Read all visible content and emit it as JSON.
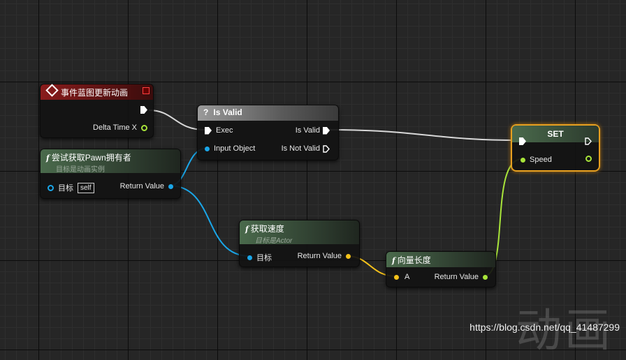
{
  "colors": {
    "exec": "#ffffff",
    "float": "#a8e43a",
    "object": "#1aa6e8",
    "vector": "#f5c21a",
    "set_outline": "#e8a020"
  },
  "event_node": {
    "icon": "event-diamond-icon",
    "title": "事件蓝图更新动画",
    "pin_delta": "Delta Time X"
  },
  "isvalid_node": {
    "icon": "question-icon",
    "title": "Is Valid",
    "pin_exec": "Exec",
    "pin_input": "Input Object",
    "pin_is_valid": "Is Valid",
    "pin_is_not_valid": "Is Not Valid"
  },
  "trypawn_node": {
    "icon": "function-icon",
    "title": "尝试获取Pawn拥有者",
    "subtitle": "目标是动画实例",
    "pin_target": "目标",
    "self_label": "self",
    "pin_return": "Return Value"
  },
  "getvelocity_node": {
    "icon": "function-icon",
    "title": "获取速度",
    "subtitle": "目标是Actor",
    "pin_target": "目标",
    "pin_return": "Return Value"
  },
  "vectorlength_node": {
    "icon": "function-icon",
    "title": "向量长度",
    "pin_a": "A",
    "pin_return": "Return Value"
  },
  "set_node": {
    "title": "SET",
    "pin_speed": "Speed"
  },
  "watermark": "https://blog.csdn.net/qq_41487299",
  "background_text": "动画"
}
